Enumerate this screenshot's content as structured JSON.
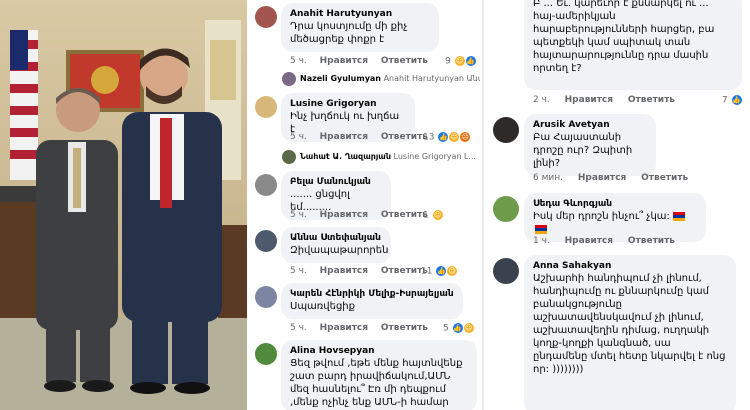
{
  "colors": {
    "link": "#1877f2",
    "muted": "#65676b",
    "bubble": "#f0f2f5"
  },
  "left_comments": [
    {
      "author": "Anahit Harutyunyan",
      "text": "Դրա կոստյումը մի քիչ մեծացրեք փոքր է",
      "time": "5 ч.",
      "like": "Нравится",
      "reply": "Ответить",
      "count": "9",
      "reactions": [
        "like-icon",
        "haha-icon"
      ]
    },
    {
      "author": "Lusine Grigoryan",
      "text": "Ինչ խղճուկ ու խղճա է",
      "time": "5 ч.",
      "like": "Нравится",
      "reply": "Ответить",
      "count": "13",
      "reactions": [
        "like-icon",
        "haha-icon",
        "angry-icon"
      ]
    },
    {
      "author": "Բելա Մանուկյան",
      "text": "....... ցնցվոլ եմ.........",
      "time": "5 ч.",
      "like": "Нравится",
      "reply": "Ответить",
      "count": "1",
      "reactions": [
        "haha-icon"
      ]
    },
    {
      "author": "Աննա Ստեփանյան",
      "text": "Զիվապաթարորեն",
      "time": "5 ч.",
      "like": "Нравится",
      "reply": "Ответить",
      "count": "11",
      "reactions": [
        "like-icon",
        "haha-icon"
      ]
    },
    {
      "author": "Կարեն Հէնրիկի Մելիք-Իսրայելյան",
      "text": "Սպառվեցիք",
      "time": "5 ч.",
      "like": "Нравится",
      "reply": "Ответить",
      "count": "5",
      "reactions": [
        "like-icon",
        "haha-icon"
      ]
    },
    {
      "author": "Alina Hovsepyan",
      "text": "Ցեզ թվում ,եթե մենք հայտնվենք շատ բարդ իրավիճակում,ԱՄՆ մեզ հասնելու՞ Էռ մի դեպքում ,մենք ոչինչ ենք ԱՄՆ-ի համար"
    }
  ],
  "left_replies": [
    {
      "author": "Nazeli Gyulumyan",
      "text": "Anahit Harutyunyan Անահ..."
    },
    {
      "author": "Նահաt Ա. Ղազարյան",
      "text": "Lusine Grigoryan Լ..."
    }
  ],
  "right_comments": [
    {
      "author": "",
      "text": "Բ ... Եւ. կարեւոր է քննարկել ու ... հայ-ամերիկյան հարաբերությունների հարցեր, բա պետքեկի կամ սպիտակ տան հայտարարություննը դրա մասին որտեղ է?",
      "time": "2 ч.",
      "like": "Нравится",
      "reply": "Ответить",
      "count": "7",
      "reactions": [
        "like-icon"
      ]
    },
    {
      "author": "Arusik Avetyan",
      "text": "Բա Հայաստանի դրոշը ուր? Զպիտի լինի?",
      "time": "6 мин.",
      "like": "Нравится",
      "reply": "Ответить"
    },
    {
      "author": "Սեդա Գևորգյան",
      "text": "Իսկ մեր դրոշն ինչու՞ չկա:",
      "time": "1 ч.",
      "like": "Нравится",
      "reply": "Ответить"
    },
    {
      "author": "Anna Sahakyan",
      "text": "Աշխարհի հանդիպում չի լինում, հանդիպումը ու քննարկումը կամ բանակցությունը աշխատավենսկավում չի լինում, աշխատավեղին դիմաց, ուղղակի կողք-կողքի կանգնած, սա ընդամենը մտել հետը նկարվել է ոնց որ: ))))))))"
    }
  ]
}
